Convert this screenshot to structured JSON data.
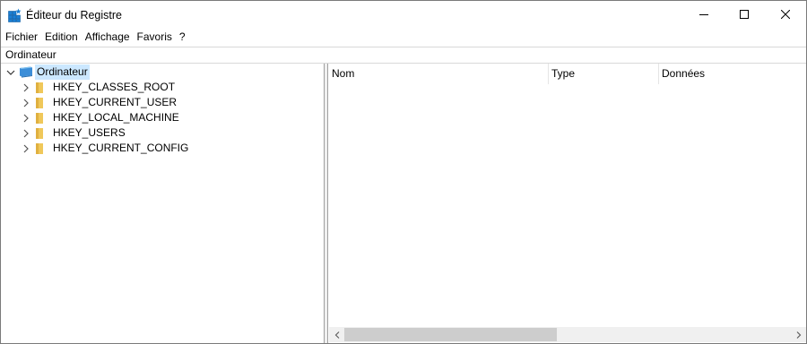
{
  "window": {
    "title": "Éditeur du Registre"
  },
  "menu": [
    "Fichier",
    "Edition",
    "Affichage",
    "Favoris",
    "?"
  ],
  "address": "Ordinateur",
  "tree": {
    "root": {
      "label": "Ordinateur",
      "expanded": true,
      "selected": true
    },
    "children": [
      {
        "label": "HKEY_CLASSES_ROOT"
      },
      {
        "label": "HKEY_CURRENT_USER"
      },
      {
        "label": "HKEY_LOCAL_MACHINE"
      },
      {
        "label": "HKEY_USERS"
      },
      {
        "label": "HKEY_CURRENT_CONFIG"
      }
    ]
  },
  "columns": [
    "Nom",
    "Type",
    "Données"
  ],
  "colors": {
    "selection": "#cce8ff",
    "folder": "#f0c85a",
    "computer": "#3c8ed8"
  },
  "icons": {
    "app": "registry-editor-icon",
    "computer": "computer-icon",
    "folder": "folder-icon",
    "minimize": "minimize-icon",
    "maximize": "maximize-icon",
    "close": "close-icon",
    "expand": "chevron-right-icon",
    "collapse": "chevron-down-icon"
  }
}
